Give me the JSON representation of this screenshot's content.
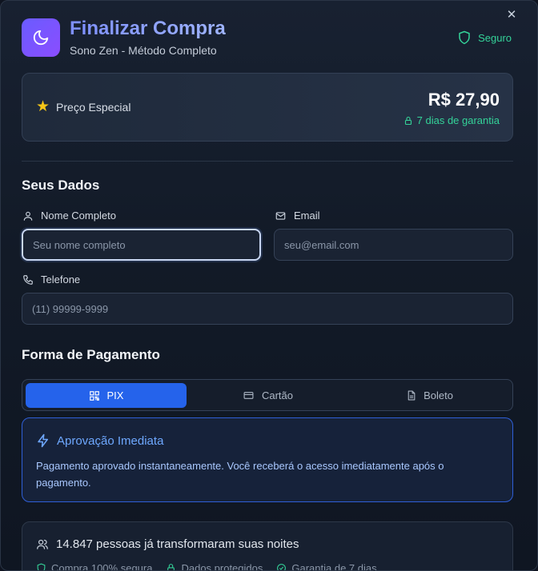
{
  "header": {
    "title": "Finalizar Compra",
    "subtitle": "Sono Zen - Método Completo",
    "secure_label": "Seguro",
    "close_glyph": "✕",
    "logo_icon": "moon-icon"
  },
  "price": {
    "label": "Preço Especial",
    "value": "R$ 27,90",
    "guarantee": "7 dias de garantia"
  },
  "form": {
    "section_title": "Seus Dados",
    "name": {
      "label": "Nome Completo",
      "placeholder": "Seu nome completo",
      "value": ""
    },
    "email": {
      "label": "Email",
      "placeholder": "seu@email.com",
      "value": ""
    },
    "phone": {
      "label": "Telefone",
      "placeholder": "(11) 99999-9999",
      "value": ""
    }
  },
  "payment": {
    "section_title": "Forma de Pagamento",
    "tabs": [
      {
        "label": "PIX",
        "icon": "qr-code-icon",
        "active": true
      },
      {
        "label": "Cartão",
        "icon": "credit-card-icon",
        "active": false
      },
      {
        "label": "Boleto",
        "icon": "document-icon",
        "active": false
      }
    ],
    "info_title": "Aprovação Imediata",
    "info_text": "Pagamento aprovado instantaneamente. Você receberá o acesso imediatamente após o pagamento."
  },
  "social_proof": {
    "headline": "14.847 pessoas já transformaram suas noites",
    "badges": [
      "Compra 100% segura",
      "Dados protegidos",
      "Garantia de 7 dias"
    ]
  },
  "colors": {
    "accent": "#2563eb",
    "success": "#34d399",
    "title": "#8ea5ff",
    "star": "#f5c518"
  }
}
